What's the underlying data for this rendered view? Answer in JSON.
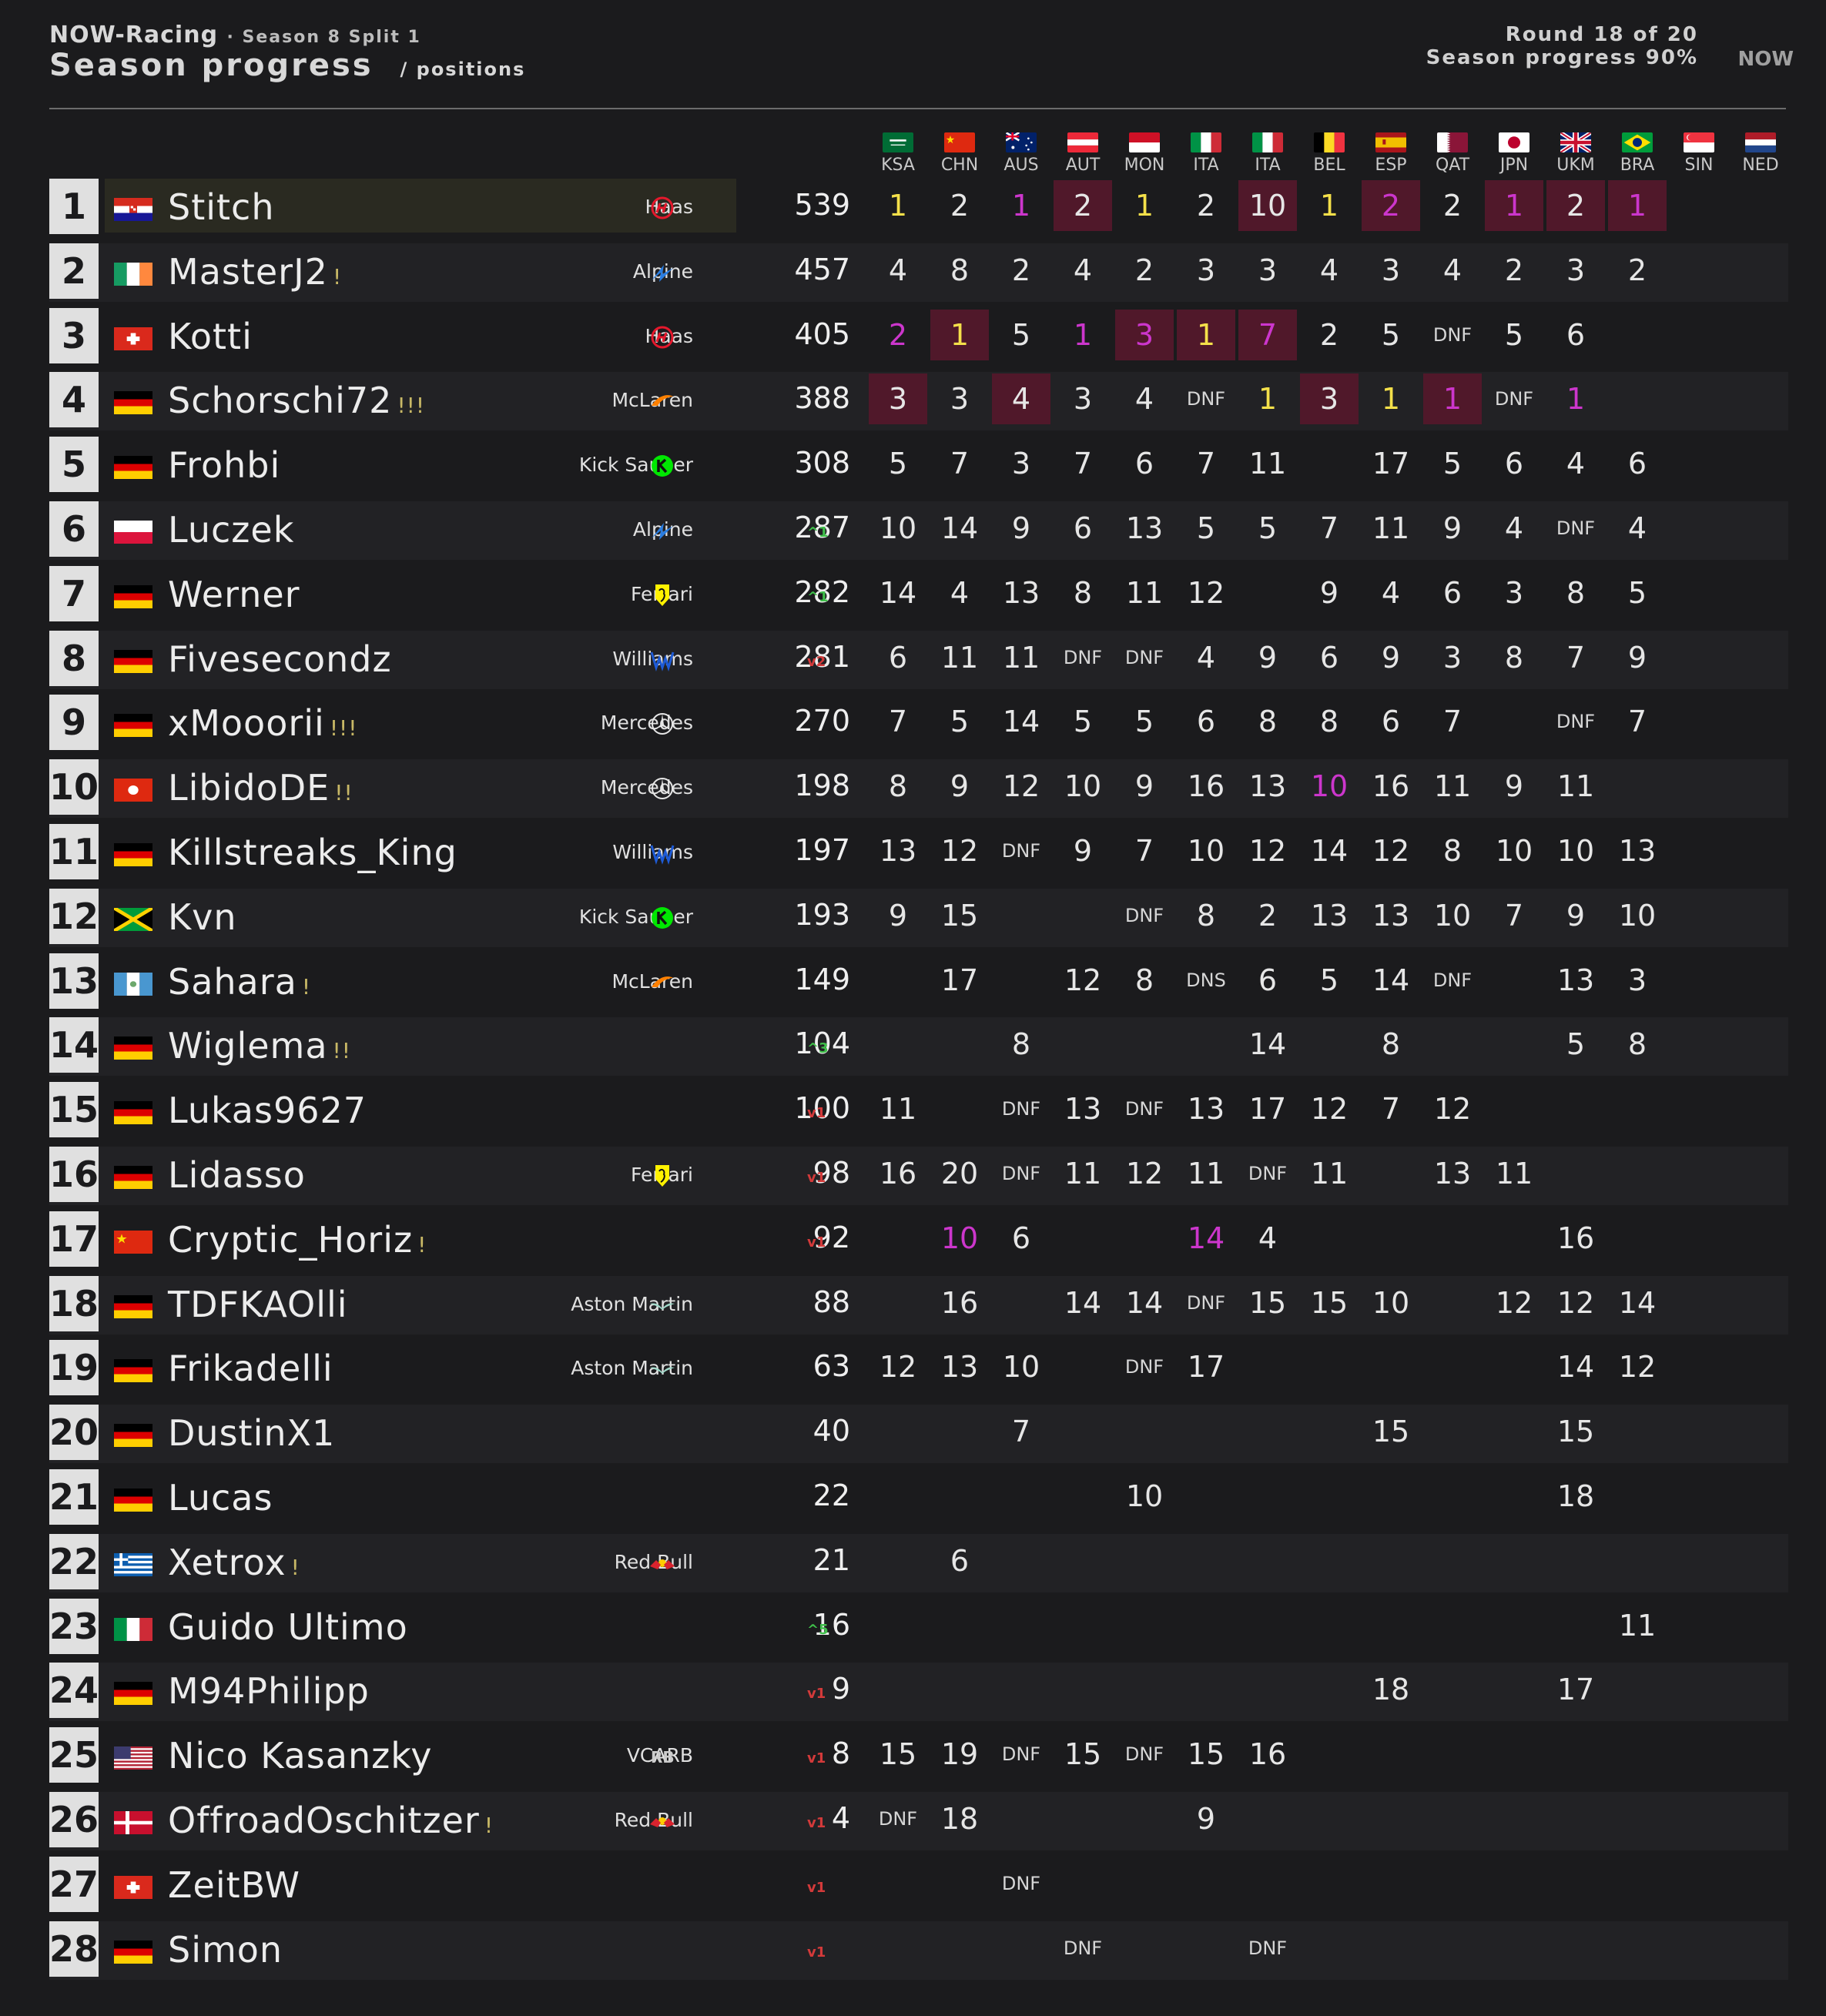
{
  "header": {
    "brand": "NOW-Racing",
    "season": "· Season 8 Split 1",
    "title": "Season progress",
    "subtitle": "/ positions",
    "round": "Round 18 of 20",
    "progress": "Season progress 90%",
    "logo": "NOW"
  },
  "races": [
    "KSA",
    "CHN",
    "AUS",
    "AUT",
    "MON",
    "ITA",
    "ITA",
    "BEL",
    "ESP",
    "QAT",
    "JPN",
    "UKM",
    "BRA",
    "SIN",
    "NED"
  ],
  "colors": {
    "background": "#1b1b1d",
    "winner_text": "#f4e04a",
    "fastest_lap_text": "#cc36cc",
    "highlight_cell": "#50182a",
    "points_up": "#3fbf4a",
    "points_down": "#d33a3a"
  },
  "drivers": [
    {
      "pos": "1",
      "name": "Stitch",
      "trophies": "",
      "flag": "hr",
      "team": "Haas",
      "team_icon": "haas-icon",
      "points": "539",
      "change": "",
      "results": [
        "1",
        "2",
        "1",
        "2",
        "1",
        "2",
        "10",
        "1",
        "2",
        "2",
        "1",
        "2",
        "1",
        "",
        ""
      ],
      "styles": [
        "y",
        "",
        "p",
        "b",
        "y",
        "",
        "b",
        "y",
        "bp",
        "",
        "bp",
        "b",
        "bp",
        "",
        ""
      ]
    },
    {
      "pos": "2",
      "name": "MasterJ2",
      "trophies": "!",
      "flag": "ie",
      "team": "Alpine",
      "team_icon": "alpine-icon",
      "points": "457",
      "change": "",
      "results": [
        "4",
        "8",
        "2",
        "4",
        "2",
        "3",
        "3",
        "4",
        "3",
        "4",
        "2",
        "3",
        "2",
        "",
        ""
      ],
      "styles": [
        "",
        "",
        "",
        "",
        "",
        "",
        "",
        "",
        "",
        "",
        "",
        "",
        "",
        "",
        ""
      ]
    },
    {
      "pos": "3",
      "name": "Kotti",
      "trophies": "",
      "flag": "ch",
      "team": "Haas",
      "team_icon": "haas-icon",
      "points": "405",
      "change": "",
      "results": [
        "2",
        "1",
        "5",
        "1",
        "3",
        "1",
        "7",
        "2",
        "5",
        "DNF",
        "5",
        "6",
        "",
        "",
        ""
      ],
      "styles": [
        "p",
        "by",
        "",
        "p",
        "bp",
        "by",
        "bp",
        "",
        "",
        "",
        "",
        "",
        "",
        "",
        ""
      ]
    },
    {
      "pos": "4",
      "name": "Schorschi72",
      "trophies": "!!!",
      "flag": "de",
      "team": "McLaren",
      "team_icon": "mclaren-icon",
      "points": "388",
      "change": "",
      "results": [
        "3",
        "3",
        "4",
        "3",
        "4",
        "DNF",
        "1",
        "3",
        "1",
        "1",
        "DNF",
        "1",
        "",
        "",
        ""
      ],
      "styles": [
        "b",
        "",
        "b",
        "",
        "",
        "",
        "y",
        "b",
        "y",
        "bp",
        "",
        "p",
        "",
        "",
        ""
      ]
    },
    {
      "pos": "5",
      "name": "Frohbi",
      "trophies": "",
      "flag": "de",
      "team": "Kick Sauber",
      "team_icon": "sauber-icon",
      "points": "308",
      "change": "",
      "results": [
        "5",
        "7",
        "3",
        "7",
        "6",
        "7",
        "11",
        "",
        "17",
        "5",
        "6",
        "4",
        "6",
        "",
        ""
      ],
      "styles": [
        "",
        "",
        "",
        "",
        "",
        "",
        "",
        "",
        "",
        "",
        "",
        "",
        "",
        "",
        ""
      ]
    },
    {
      "pos": "6",
      "name": "Luczek",
      "trophies": "",
      "flag": "pl",
      "team": "Alpine",
      "team_icon": "alpine-icon",
      "points": "287",
      "change": "^1",
      "change_dir": "up",
      "results": [
        "10",
        "14",
        "9",
        "6",
        "13",
        "5",
        "5",
        "7",
        "11",
        "9",
        "4",
        "DNF",
        "4",
        "",
        ""
      ],
      "styles": [
        "",
        "",
        "",
        "",
        "",
        "",
        "",
        "",
        "",
        "",
        "",
        "",
        "",
        "",
        ""
      ]
    },
    {
      "pos": "7",
      "name": "Werner",
      "trophies": "",
      "flag": "de",
      "team": "Ferrari",
      "team_icon": "ferrari-icon",
      "points": "282",
      "change": "^1",
      "change_dir": "up",
      "results": [
        "14",
        "4",
        "13",
        "8",
        "11",
        "12",
        "",
        "9",
        "4",
        "6",
        "3",
        "8",
        "5",
        "",
        ""
      ],
      "styles": [
        "",
        "",
        "",
        "",
        "",
        "",
        "",
        "",
        "",
        "",
        "",
        "",
        "",
        "",
        ""
      ]
    },
    {
      "pos": "8",
      "name": "Fivesecondz",
      "trophies": "",
      "flag": "de",
      "team": "Williams",
      "team_icon": "williams-icon",
      "points": "281",
      "change": "v2",
      "change_dir": "dn",
      "results": [
        "6",
        "11",
        "11",
        "DNF",
        "DNF",
        "4",
        "9",
        "6",
        "9",
        "3",
        "8",
        "7",
        "9",
        "",
        ""
      ],
      "styles": [
        "",
        "",
        "",
        "",
        "",
        "",
        "",
        "",
        "",
        "",
        "",
        "",
        "",
        "",
        ""
      ]
    },
    {
      "pos": "9",
      "name": "xMooorii",
      "trophies": "!!!",
      "flag": "de",
      "team": "Mercedes",
      "team_icon": "mercedes-icon",
      "points": "270",
      "change": "",
      "results": [
        "7",
        "5",
        "14",
        "5",
        "5",
        "6",
        "8",
        "8",
        "6",
        "7",
        "",
        "DNF",
        "7",
        "",
        ""
      ],
      "styles": [
        "",
        "",
        "",
        "",
        "",
        "",
        "",
        "",
        "",
        "",
        "",
        "",
        "",
        "",
        ""
      ]
    },
    {
      "pos": "10",
      "name": "LibidoDE",
      "trophies": "!!",
      "flag": "hk",
      "team": "Mercedes",
      "team_icon": "mercedes-icon",
      "points": "198",
      "change": "",
      "results": [
        "8",
        "9",
        "12",
        "10",
        "9",
        "16",
        "13",
        "10",
        "16",
        "11",
        "9",
        "11",
        "",
        "",
        ""
      ],
      "styles": [
        "",
        "",
        "",
        "",
        "",
        "",
        "",
        "p",
        "",
        "",
        "",
        "",
        "",
        "",
        ""
      ]
    },
    {
      "pos": "11",
      "name": "Killstreaks_King",
      "trophies": "",
      "flag": "de",
      "team": "Williams",
      "team_icon": "williams-icon",
      "points": "197",
      "change": "",
      "results": [
        "13",
        "12",
        "DNF",
        "9",
        "7",
        "10",
        "12",
        "14",
        "12",
        "8",
        "10",
        "10",
        "13",
        "",
        ""
      ],
      "styles": [
        "",
        "",
        "",
        "",
        "",
        "",
        "",
        "",
        "",
        "",
        "",
        "",
        "",
        "",
        ""
      ]
    },
    {
      "pos": "12",
      "name": "Kvn",
      "trophies": "",
      "flag": "jm",
      "team": "Kick Sauber",
      "team_icon": "sauber-icon",
      "points": "193",
      "change": "",
      "results": [
        "9",
        "15",
        "",
        "",
        "DNF",
        "8",
        "2",
        "13",
        "13",
        "10",
        "7",
        "9",
        "10",
        "",
        ""
      ],
      "styles": [
        "",
        "",
        "",
        "",
        "",
        "",
        "",
        "",
        "",
        "",
        "",
        "",
        "",
        "",
        ""
      ]
    },
    {
      "pos": "13",
      "name": "Sahara",
      "trophies": "!",
      "flag": "gt",
      "team": "McLaren",
      "team_icon": "mclaren-icon",
      "points": "149",
      "change": "",
      "results": [
        "",
        "17",
        "",
        "12",
        "8",
        "DNS",
        "6",
        "5",
        "14",
        "DNF",
        "",
        "13",
        "3",
        "",
        ""
      ],
      "styles": [
        "",
        "",
        "",
        "",
        "",
        "",
        "",
        "",
        "",
        "",
        "",
        "",
        "",
        "",
        ""
      ]
    },
    {
      "pos": "14",
      "name": "Wiglema",
      "trophies": "!!",
      "flag": "de",
      "team": "",
      "team_icon": "",
      "points": "104",
      "change": "^3",
      "change_dir": "up",
      "results": [
        "",
        "",
        "8",
        "",
        "",
        "",
        "14",
        "",
        "8",
        "",
        "",
        "5",
        "8",
        "",
        ""
      ],
      "styles": [
        "",
        "",
        "",
        "",
        "",
        "",
        "",
        "",
        "",
        "",
        "",
        "",
        "",
        "",
        ""
      ]
    },
    {
      "pos": "15",
      "name": "Lukas9627",
      "trophies": "",
      "flag": "de",
      "team": "",
      "team_icon": "",
      "points": "100",
      "change": "v1",
      "change_dir": "dn",
      "results": [
        "11",
        "",
        "DNF",
        "13",
        "DNF",
        "13",
        "17",
        "12",
        "7",
        "12",
        "",
        "",
        "",
        "",
        ""
      ],
      "styles": [
        "",
        "",
        "",
        "",
        "",
        "",
        "",
        "",
        "",
        "",
        "",
        "",
        "",
        "",
        ""
      ]
    },
    {
      "pos": "16",
      "name": "Lidasso",
      "trophies": "",
      "flag": "de",
      "team": "Ferrari",
      "team_icon": "ferrari-icon",
      "points": "98",
      "change": "v1",
      "change_dir": "dn",
      "results": [
        "16",
        "20",
        "DNF",
        "11",
        "12",
        "11",
        "DNF",
        "11",
        "",
        "13",
        "11",
        "",
        "",
        "",
        ""
      ],
      "styles": [
        "",
        "",
        "",
        "",
        "",
        "",
        "",
        "",
        "",
        "",
        "",
        "",
        "",
        "",
        ""
      ]
    },
    {
      "pos": "17",
      "name": "Cryptic_Horiz",
      "trophies": "!",
      "flag": "cn",
      "team": "",
      "team_icon": "",
      "points": "92",
      "change": "v1",
      "change_dir": "dn",
      "results": [
        "",
        "10",
        "6",
        "",
        "",
        "14",
        "4",
        "",
        "",
        "",
        "",
        "16",
        "",
        "",
        ""
      ],
      "styles": [
        "",
        "p",
        "",
        "",
        "",
        "p",
        "",
        "",
        "",
        "",
        "",
        "",
        "",
        "",
        ""
      ]
    },
    {
      "pos": "18",
      "name": "TDFKAOlli",
      "trophies": "",
      "flag": "de",
      "team": "Aston Martin",
      "team_icon": "aston-icon",
      "points": "88",
      "change": "",
      "results": [
        "",
        "16",
        "",
        "14",
        "14",
        "DNF",
        "15",
        "15",
        "10",
        "",
        "12",
        "12",
        "14",
        "",
        ""
      ],
      "styles": [
        "",
        "",
        "",
        "",
        "",
        "",
        "",
        "",
        "",
        "",
        "",
        "",
        "",
        "",
        ""
      ]
    },
    {
      "pos": "19",
      "name": "Frikadelli",
      "trophies": "",
      "flag": "de",
      "team": "Aston Martin",
      "team_icon": "aston-icon",
      "points": "63",
      "change": "",
      "results": [
        "12",
        "13",
        "10",
        "",
        "DNF",
        "17",
        "",
        "",
        "",
        "",
        "",
        "14",
        "12",
        "",
        ""
      ],
      "styles": [
        "",
        "",
        "",
        "",
        "",
        "",
        "",
        "",
        "",
        "",
        "",
        "",
        "",
        "",
        ""
      ]
    },
    {
      "pos": "20",
      "name": "DustinX1",
      "trophies": "",
      "flag": "de",
      "team": "",
      "team_icon": "",
      "points": "40",
      "change": "",
      "results": [
        "",
        "",
        "7",
        "",
        "",
        "",
        "",
        "",
        "15",
        "",
        "",
        "15",
        "",
        "",
        ""
      ],
      "styles": [
        "",
        "",
        "",
        "",
        "",
        "",
        "",
        "",
        "",
        "",
        "",
        "",
        "",
        "",
        ""
      ]
    },
    {
      "pos": "21",
      "name": "Lucas",
      "trophies": "",
      "flag": "de",
      "team": "",
      "team_icon": "",
      "points": "22",
      "change": "",
      "results": [
        "",
        "",
        "",
        "",
        "10",
        "",
        "",
        "",
        "",
        "",
        "",
        "18",
        "",
        "",
        ""
      ],
      "styles": [
        "",
        "",
        "",
        "",
        "",
        "",
        "",
        "",
        "",
        "",
        "",
        "",
        "",
        "",
        ""
      ]
    },
    {
      "pos": "22",
      "name": "Xetrox",
      "trophies": "!",
      "flag": "gr",
      "team": "Red Bull",
      "team_icon": "redbull-icon",
      "points": "21",
      "change": "",
      "results": [
        "",
        "6",
        "",
        "",
        "",
        "",
        "",
        "",
        "",
        "",
        "",
        "",
        "",
        "",
        ""
      ],
      "styles": [
        "",
        "",
        "",
        "",
        "",
        "",
        "",
        "",
        "",
        "",
        "",
        "",
        "",
        "",
        ""
      ]
    },
    {
      "pos": "23",
      "name": "Guido Ultimo",
      "trophies": "",
      "flag": "it",
      "team": "",
      "team_icon": "",
      "points": "16",
      "change": "^5",
      "change_dir": "up",
      "results": [
        "",
        "",
        "",
        "",
        "",
        "",
        "",
        "",
        "",
        "",
        "",
        "",
        "11",
        "",
        ""
      ],
      "styles": [
        "",
        "",
        "",
        "",
        "",
        "",
        "",
        "",
        "",
        "",
        "",
        "",
        "",
        "",
        ""
      ]
    },
    {
      "pos": "24",
      "name": "M94Philipp",
      "trophies": "",
      "flag": "de",
      "team": "",
      "team_icon": "",
      "points": "9",
      "change": "v1",
      "change_dir": "dn",
      "results": [
        "",
        "",
        "",
        "",
        "",
        "",
        "",
        "",
        "18",
        "",
        "",
        "17",
        "",
        "",
        ""
      ],
      "styles": [
        "",
        "",
        "",
        "",
        "",
        "",
        "",
        "",
        "",
        "",
        "",
        "",
        "",
        "",
        ""
      ]
    },
    {
      "pos": "25",
      "name": "Nico Kasanzky",
      "trophies": "",
      "flag": "us",
      "team": "VCARB",
      "team_icon": "vcarb-icon",
      "points": "8",
      "change": "v1",
      "change_dir": "dn",
      "results": [
        "15",
        "19",
        "DNF",
        "15",
        "DNF",
        "15",
        "16",
        "",
        "",
        "",
        "",
        "",
        "",
        "",
        ""
      ],
      "styles": [
        "",
        "",
        "",
        "",
        "",
        "",
        "",
        "",
        "",
        "",
        "",
        "",
        "",
        "",
        ""
      ]
    },
    {
      "pos": "26",
      "name": "OffroadOschitzer",
      "trophies": "!",
      "flag": "dk",
      "team": "Red Bull",
      "team_icon": "redbull-icon",
      "points": "4",
      "change": "v1",
      "change_dir": "dn",
      "results": [
        "DNF",
        "18",
        "",
        "",
        "",
        "9",
        "",
        "",
        "",
        "",
        "",
        "",
        "",
        "",
        ""
      ],
      "styles": [
        "",
        "",
        "",
        "",
        "",
        "",
        "",
        "",
        "",
        "",
        "",
        "",
        "",
        "",
        ""
      ]
    },
    {
      "pos": "27",
      "name": "ZeitBW",
      "trophies": "",
      "flag": "ch",
      "team": "",
      "team_icon": "",
      "points": "",
      "change": "v1",
      "change_dir": "dn",
      "results": [
        "",
        "",
        "DNF",
        "",
        "",
        "",
        "",
        "",
        "",
        "",
        "",
        "",
        "",
        "",
        ""
      ],
      "styles": [
        "",
        "",
        "",
        "",
        "",
        "",
        "",
        "",
        "",
        "",
        "",
        "",
        "",
        "",
        ""
      ]
    },
    {
      "pos": "28",
      "name": "Simon",
      "trophies": "",
      "flag": "de",
      "team": "",
      "team_icon": "",
      "points": "",
      "change": "v1",
      "change_dir": "dn",
      "results": [
        "",
        "",
        "",
        "DNF",
        "",
        "",
        "DNF",
        "",
        "",
        "",
        "",
        "",
        "",
        "",
        ""
      ],
      "styles": [
        "",
        "",
        "",
        "",
        "",
        "",
        "",
        "",
        "",
        "",
        "",
        "",
        "",
        "",
        ""
      ]
    }
  ]
}
